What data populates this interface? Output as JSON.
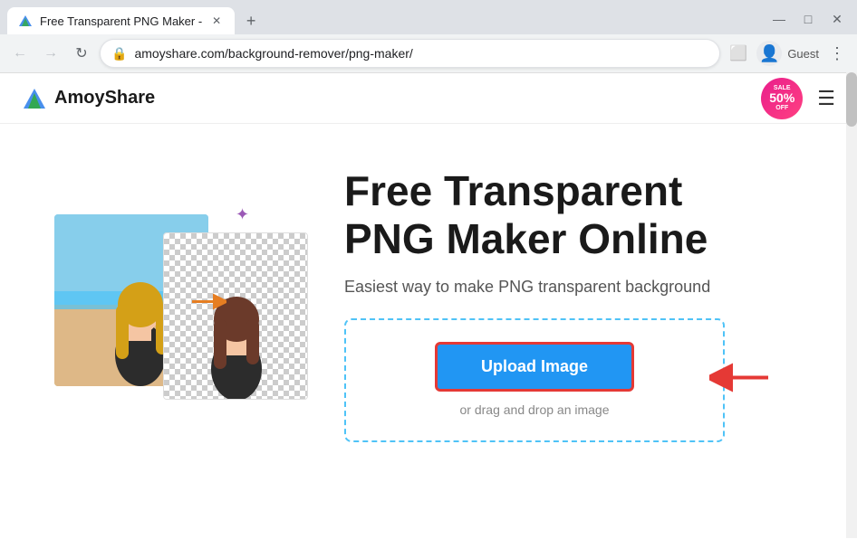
{
  "browser": {
    "tab_title": "Free Transparent PNG Maker -",
    "url": "amoyshare.com/background-remover/png-maker/",
    "guest_label": "Guest",
    "new_tab_icon": "+",
    "back_icon": "←",
    "forward_icon": "→",
    "refresh_icon": "↺"
  },
  "site": {
    "logo_text": "AmoyShare",
    "sale_top": "Sale",
    "sale_percent": "50%",
    "sale_bottom": "Off"
  },
  "page": {
    "title_line1": "Free Transparent",
    "title_line2": "PNG Maker Online",
    "subtitle": "Easiest way to make PNG transparent background",
    "upload_button": "Upload Image",
    "upload_hint": "or drag and drop an image"
  }
}
